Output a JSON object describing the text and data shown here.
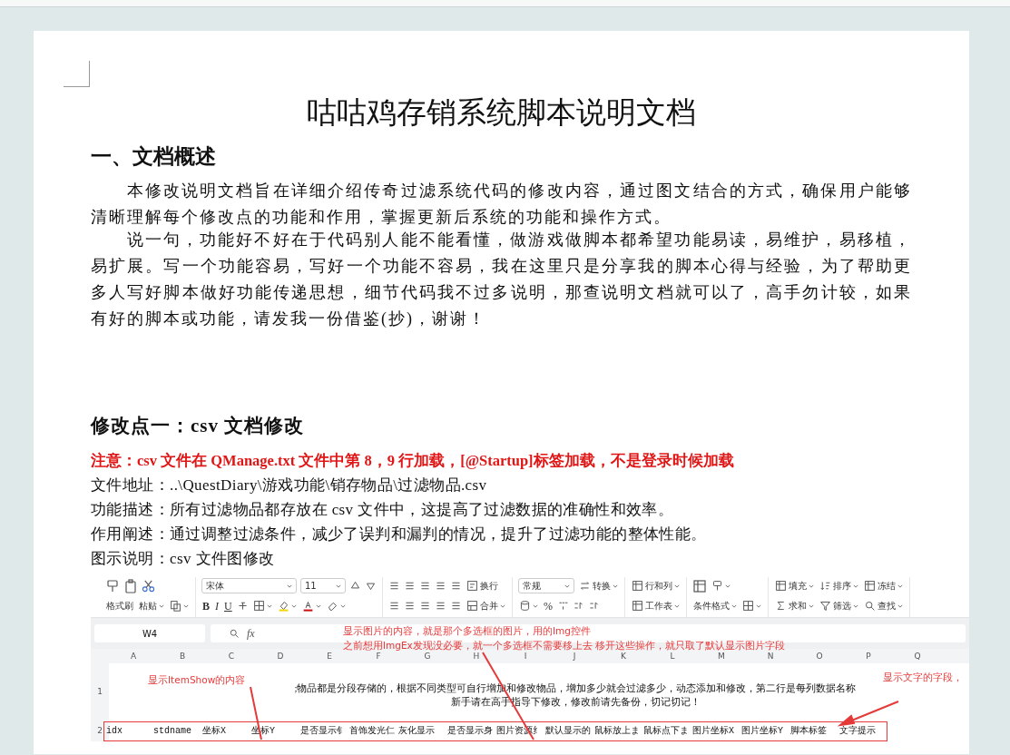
{
  "title": "咕咕鸡存销系统脚本说明文档",
  "section_1": {
    "heading": "一、文档概述",
    "paragraphs": [
      "本修改说明文档旨在详细介绍传奇过滤系统代码的修改内容，通过图文结合的方式，确保用户能够清晰理解每个修改点的功能和作用，掌握更新后系统的功能和操作方式。",
      "说一句，功能好不好在于代码别人能不能看懂，做游戏做脚本都希望功能易读，易维护，易移植，易扩展。写一个功能容易，写好一个功能不容易，我在这里只是分享我的脚本心得与经验，为了帮助更多人写好脚本做好功能传递思想，细节代码我不过多说明，那查说明文档就可以了，高手勿计较，如果有好的脚本或功能，请发我一份借鉴(抄)，谢谢！"
    ]
  },
  "section_2": {
    "heading": "修改点一：csv 文档修改",
    "notice": "注意：csv 文件在 QManage.txt 文件中第 8，9 行加载，[@Startup]标签加载，不是登录时候加载",
    "lines": [
      "文件地址：..\\QuestDiary\\游戏功能\\销存物品\\过滤物品.csv",
      "功能描述：所有过滤物品都存放在 csv 文件中，这提高了过滤数据的准确性和效率。",
      "作用阐述：通过调整过滤条件，减少了误判和漏判的情况，提升了过滤功能的整体性能。",
      "图示说明：csv 文件图修改"
    ]
  },
  "figure": {
    "ribbon": {
      "font_name": "宋体",
      "font_size": "11",
      "number_format": "常规",
      "format_marks": [
        "B",
        "I",
        "U",
        "%"
      ],
      "buttons": [
        "换行",
        "转换",
        "行和列",
        "填充",
        "排序",
        "冻结",
        "格式刷",
        "粘贴",
        "合并",
        "工作表",
        "条件格式",
        "求和",
        "筛选",
        "查找"
      ]
    },
    "name_box": "W4",
    "formula_label": "fx",
    "column_headers": [
      "A",
      "B",
      "C",
      "D",
      "E",
      "F",
      "G",
      "H",
      "I",
      "J",
      "K",
      "L",
      "M",
      "N",
      "O",
      "P",
      "Q"
    ],
    "row_numbers": [
      "1",
      "2"
    ],
    "row_1_text": [
      ";物品都是分段存储的，根据不同类型可自行增加和修改物品，增加多少就会过滤多少，动态添加和修改，第二行是每列数据名称",
      "新手请在高手指导下修改，修改前请先备份，切记切记！"
    ],
    "row_2_cells": [
      "idx",
      "stdname",
      "坐标X",
      "坐标Y",
      "是否显示钅",
      "首饰发光仁",
      "灰化显示",
      "是否显示身",
      "图片资源纟",
      "默认显示的",
      "鼠标放上ま",
      "鼠标点下ま",
      "图片坐标X",
      "图片坐标Y",
      "脚本标签",
      "文字提示"
    ],
    "annotations": [
      {
        "text": "显示图片的内容，就是那个多选框的图片，用的Img控件"
      },
      {
        "text": "之前想用ImgEx发现没必要，就一个多选框不需要移上去 移开这些操作，就只取了默认显示图片字段"
      },
      {
        "text": "显示ItemShow的内容"
      },
      {
        "text": "显示文字的字段，"
      }
    ]
  }
}
